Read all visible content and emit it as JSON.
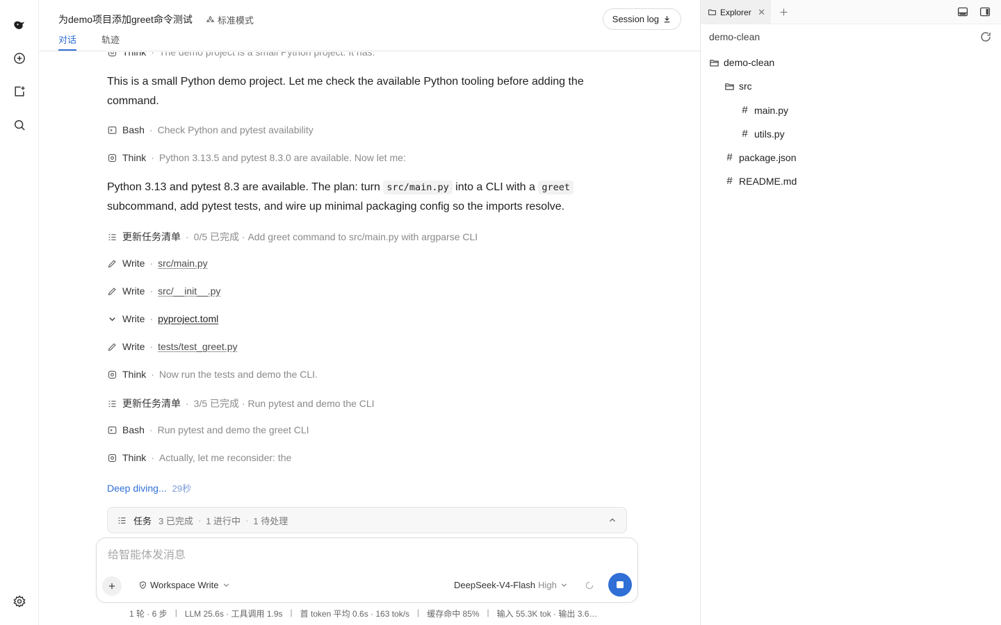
{
  "header": {
    "title": "为demo项目添加greet命令测试",
    "mode": "标准模式",
    "session_log": "Session log",
    "tabs": [
      {
        "label": "对话"
      },
      {
        "label": "轨迹"
      }
    ]
  },
  "chat": {
    "top_partial": {
      "label": "Think",
      "desc": "The demo project is a small Python project. It has:"
    },
    "para1": "This is a small Python demo project. Let me check the available Python tooling before adding the command.",
    "items": [
      {
        "type": "bash",
        "label": "Bash",
        "desc": "Check Python and pytest availability"
      },
      {
        "type": "think",
        "label": "Think",
        "desc": "Python 3.13.5 and pytest 8.3.0 are available. Now let me:"
      }
    ],
    "para2": {
      "t1": "Python 3.13 and pytest 8.3 are available. The plan: turn ",
      "code1": "src/main.py",
      "t2": " into a CLI with a ",
      "code2": "greet",
      "t3": " subcommand, add pytest tests, and wire up minimal packaging config so the imports resolve."
    },
    "steps": [
      {
        "type": "todo",
        "label": "更新任务清单",
        "desc": "0/5 已完成 · Add greet command to src/main.py with argparse CLI"
      },
      {
        "type": "write",
        "label": "Write",
        "file": "src/main.py"
      },
      {
        "type": "write",
        "label": "Write",
        "file": "src/__init__.py"
      },
      {
        "type": "write-open",
        "label": "Write",
        "file": "pyproject.toml"
      },
      {
        "type": "write",
        "label": "Write",
        "file": "tests/test_greet.py"
      },
      {
        "type": "think",
        "label": "Think",
        "desc": "Now run the tests and demo the CLI."
      },
      {
        "type": "todo",
        "label": "更新任务清单",
        "desc": "3/5 已完成 · Run pytest and demo the CLI"
      },
      {
        "type": "bash",
        "label": "Bash",
        "desc": "Run pytest and demo the greet CLI"
      },
      {
        "type": "think",
        "label": "Think",
        "desc": "Actually, let me reconsider: the"
      }
    ],
    "deep_diving": {
      "label": "Deep diving...",
      "time": "29秒"
    }
  },
  "tasks": {
    "title": "任务",
    "done": "3 已完成",
    "in_progress": "1 进行中",
    "pending": "1 待处理"
  },
  "composer": {
    "placeholder": "给智能体发消息",
    "value": "",
    "permission": "Workspace Write",
    "model": "DeepSeek-V4-Flash",
    "effort": "High"
  },
  "statusline": [
    "1 轮 · 6 步",
    "LLM 25.6s · 工具调用 1.9s",
    "首 token 平均 0.6s · 163 tok/s",
    "缓存命中 85%",
    "输入 55.3K tok · 输出 3.6…"
  ],
  "explorer": {
    "tab_label": "Explorer",
    "root": "demo-clean",
    "tree": [
      {
        "name": "demo-clean",
        "kind": "folder"
      },
      {
        "name": "src",
        "kind": "folder"
      },
      {
        "name": "main.py",
        "kind": "file"
      },
      {
        "name": "utils.py",
        "kind": "file"
      },
      {
        "name": "package.json",
        "kind": "file"
      },
      {
        "name": "README.md",
        "kind": "file"
      }
    ]
  },
  "colors": {
    "accent": "#2f6fd6",
    "muted": "#8a8a8a",
    "border": "#e6e6e6"
  }
}
